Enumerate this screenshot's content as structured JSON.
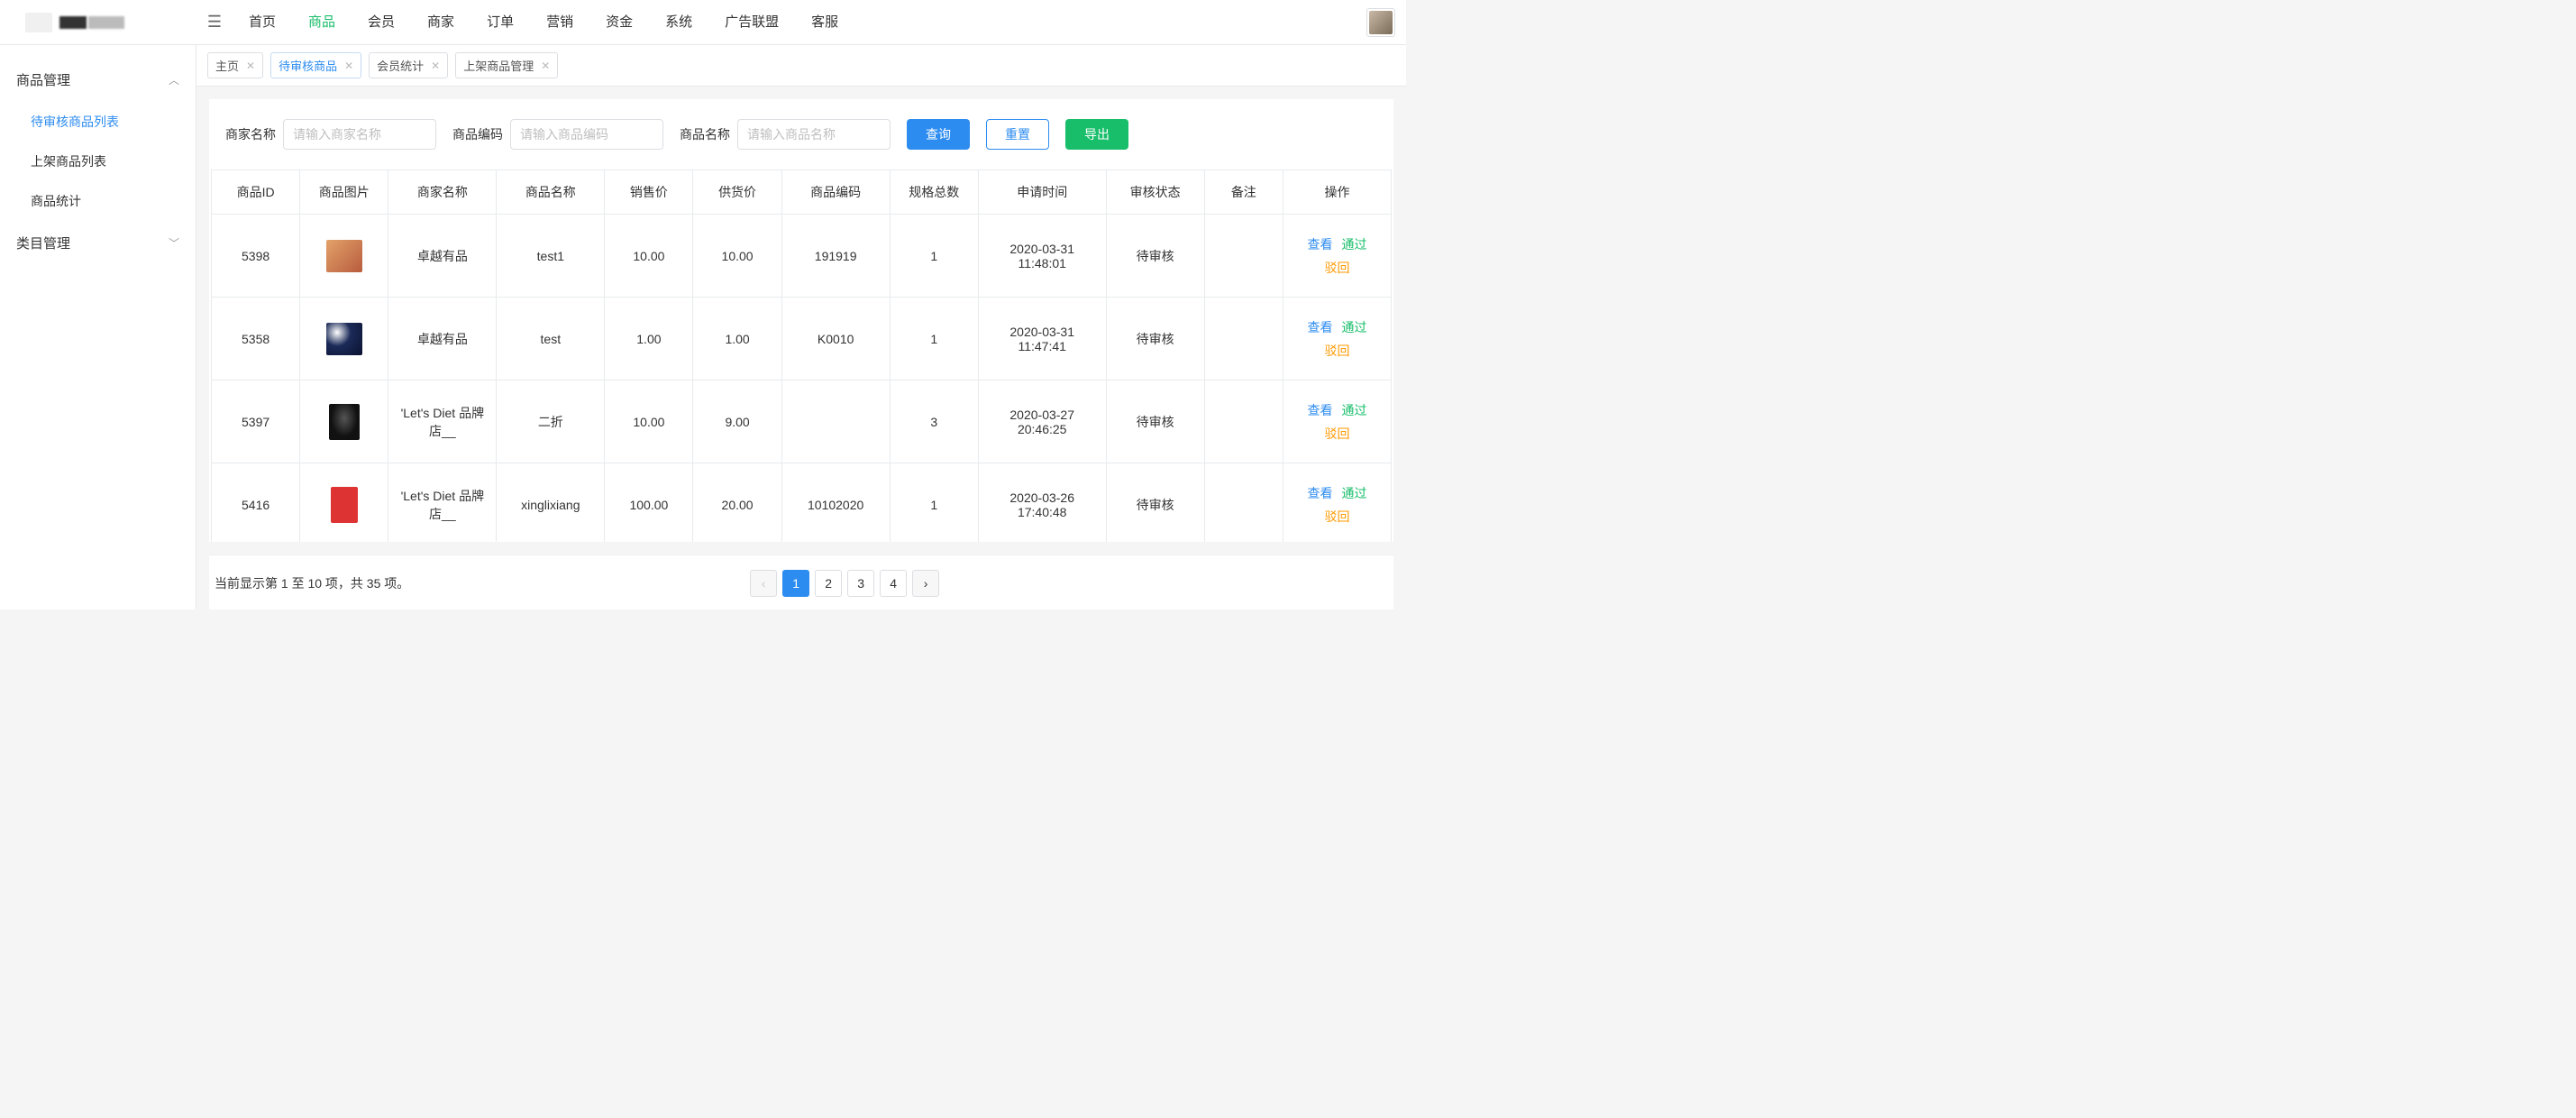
{
  "topnav": {
    "items": [
      "首页",
      "商品",
      "会员",
      "商家",
      "订单",
      "营销",
      "资金",
      "系统",
      "广告联盟",
      "客服"
    ],
    "activeIndex": 1
  },
  "sidebar": {
    "groups": [
      {
        "title": "商品管理",
        "expanded": true,
        "items": [
          "待审核商品列表",
          "上架商品列表",
          "商品统计"
        ],
        "activeIndex": 0
      },
      {
        "title": "类目管理",
        "expanded": false,
        "items": []
      }
    ]
  },
  "tabs": {
    "items": [
      "主页",
      "待审核商品",
      "会员统计",
      "上架商品管理"
    ],
    "activeIndex": 1
  },
  "filters": {
    "merchant_label": "商家名称",
    "merchant_placeholder": "请输入商家名称",
    "code_label": "商品编码",
    "code_placeholder": "请输入商品编码",
    "product_label": "商品名称",
    "product_placeholder": "请输入商品名称",
    "query_btn": "查询",
    "reset_btn": "重置",
    "export_btn": "导出"
  },
  "table": {
    "headers": [
      "商品ID",
      "商品图片",
      "商家名称",
      "商品名称",
      "销售价",
      "供货价",
      "商品编码",
      "规格总数",
      "申请时间",
      "审核状态",
      "备注",
      "操作"
    ],
    "op_view": "查看",
    "op_pass": "通过",
    "op_reject": "驳回",
    "rows": [
      {
        "id": "5398",
        "merchant": "卓越有品",
        "name": "test1",
        "price": "10.00",
        "supply": "10.00",
        "code": "191919",
        "specs": "1",
        "time": "2020-03-31 11:48:01",
        "status": "待审核",
        "remark": ""
      },
      {
        "id": "5358",
        "merchant": "卓越有品",
        "name": "test",
        "price": "1.00",
        "supply": "1.00",
        "code": "K0010",
        "specs": "1",
        "time": "2020-03-31 11:47:41",
        "status": "待审核",
        "remark": ""
      },
      {
        "id": "5397",
        "merchant": "'Let's Diet 品牌店__",
        "name": "二折",
        "price": "10.00",
        "supply": "9.00",
        "code": "",
        "specs": "3",
        "time": "2020-03-27 20:46:25",
        "status": "待审核",
        "remark": ""
      },
      {
        "id": "5416",
        "merchant": "'Let's Diet 品牌店__",
        "name": "xinglixiang",
        "price": "100.00",
        "supply": "20.00",
        "code": "10102020",
        "specs": "1",
        "time": "2020-03-26 17:40:48",
        "status": "待审核",
        "remark": ""
      }
    ]
  },
  "pagination": {
    "info": "当前显示第 1 至 10 项，共 35 项。",
    "pages": [
      "1",
      "2",
      "3",
      "4"
    ],
    "activeIndex": 0
  }
}
